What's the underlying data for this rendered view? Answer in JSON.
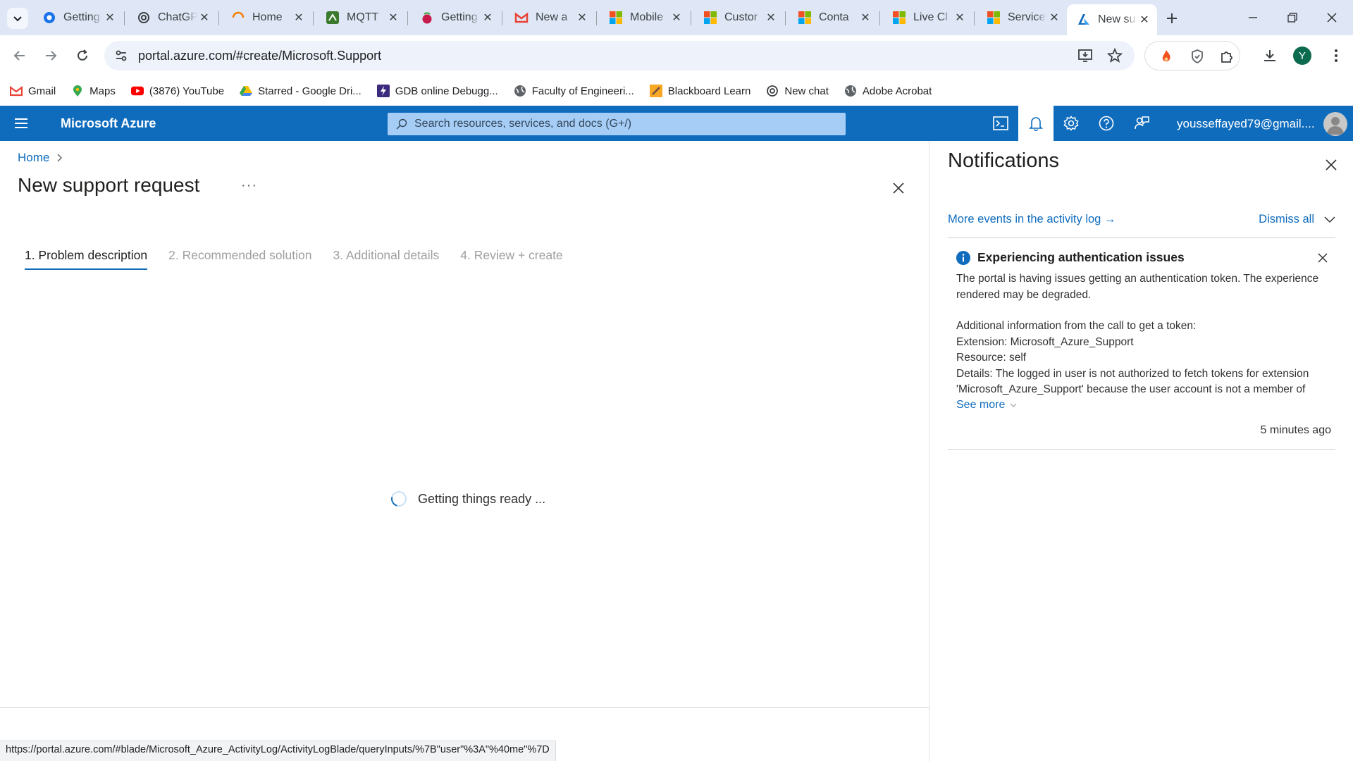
{
  "browser": {
    "tabs": [
      {
        "label": "Getting",
        "icon": "chrome-google-icon"
      },
      {
        "label": "ChatGPT",
        "icon": "openai-icon"
      },
      {
        "label": "Home",
        "icon": "loading-ring-icon"
      },
      {
        "label": "MQTT",
        "icon": "mqtt-icon"
      },
      {
        "label": "Getting",
        "icon": "raspberry-pi-icon"
      },
      {
        "label": "New a",
        "icon": "gmail-icon"
      },
      {
        "label": "Mobile",
        "icon": "microsoft-icon"
      },
      {
        "label": "Custor",
        "icon": "microsoft-icon"
      },
      {
        "label": "Conta",
        "icon": "microsoft-icon"
      },
      {
        "label": "Live Cl",
        "icon": "microsoft-icon"
      },
      {
        "label": "Service",
        "icon": "microsoft-icon"
      },
      {
        "label": "New su",
        "icon": "azure-icon",
        "active": true
      }
    ],
    "url": "portal.azure.com/#create/Microsoft.Support",
    "profile_initial": "Y",
    "bookmarks": [
      {
        "label": "Gmail",
        "icon": "gmail-icon"
      },
      {
        "label": "Maps",
        "icon": "maps-icon"
      },
      {
        "label": "(3876) YouTube",
        "icon": "youtube-icon"
      },
      {
        "label": "Starred - Google Dri...",
        "icon": "drive-icon"
      },
      {
        "label": "GDB online Debugg...",
        "icon": "gdb-icon"
      },
      {
        "label": "Faculty of Engineeri...",
        "icon": "globe-icon"
      },
      {
        "label": "Blackboard Learn",
        "icon": "blackboard-icon"
      },
      {
        "label": "New chat",
        "icon": "openai-icon"
      },
      {
        "label": "Adobe Acrobat",
        "icon": "globe-icon"
      }
    ],
    "status_url": "https://portal.azure.com/#blade/Microsoft_Azure_ActivityLog/ActivityLogBlade/queryInputs/%7B\"user\"%3A\"%40me\"%7D"
  },
  "azure": {
    "brand": "Microsoft Azure",
    "search_placeholder": "Search resources, services, and docs (G+/)",
    "user": "yousseffayed79@gmail...."
  },
  "blade": {
    "breadcrumb_home": "Home",
    "title": "New support request",
    "more": "···",
    "steps": [
      "1. Problem description",
      "2. Recommended solution",
      "3. Additional details",
      "4. Review + create"
    ],
    "loading_text": "Getting things ready ..."
  },
  "notifications": {
    "title": "Notifications",
    "activity_link": "More events in the activity log →",
    "dismiss_all": "Dismiss all",
    "card": {
      "title": "Experiencing authentication issues",
      "body1": "The portal is having issues getting an authentication token. The experience rendered may be degraded.",
      "body2": "Additional information from the call to get a token:",
      "body3": "Extension: Microsoft_Azure_Support",
      "body4": "Resource: self",
      "body5": "Details: The logged in user is not authorized to fetch tokens for extension 'Microsoft_Azure_Support' because the user account is not a member of",
      "see_more": "See more",
      "time": "5 minutes ago"
    }
  },
  "colors": {
    "azure_blue": "#0f6cbd",
    "tabstrip_bg": "#dfe7f6"
  }
}
